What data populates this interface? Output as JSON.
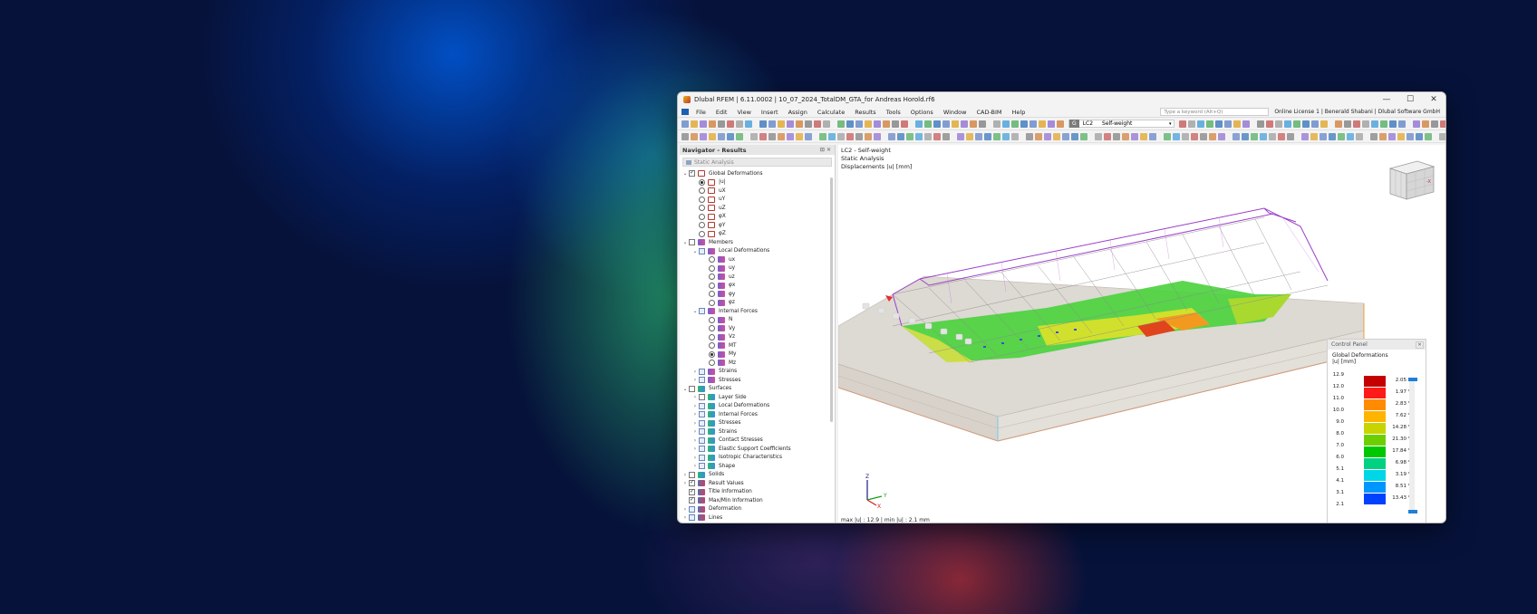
{
  "window": {
    "title": "Dlubal RFEM | 6.11.0002 | 10_07_2024_TotalDM_GTA_for Andreas Horold.rf6",
    "controls": [
      "—",
      "☐",
      "✕"
    ]
  },
  "menu": {
    "items": [
      "File",
      "Edit",
      "View",
      "Insert",
      "Assign",
      "Calculate",
      "Results",
      "Tools",
      "Options",
      "Window",
      "CAD-BIM",
      "Help"
    ],
    "search_placeholder": "Type a keyword (Alt+Q)",
    "license": "Online License 1 | Benerald Shabani | Dlubal Software GmbH"
  },
  "loadcase": {
    "code": "G",
    "id": "LC2",
    "name": "Self-weight"
  },
  "navigator": {
    "title": "Navigator - Results",
    "analysis": "Static Analysis",
    "tree": [
      {
        "level": 0,
        "exp": "v",
        "ctrl": "check-on",
        "icon": "def",
        "label": "Global Deformations"
      },
      {
        "level": 1,
        "exp": "",
        "ctrl": "radio-on",
        "icon": "def",
        "label": "|u|"
      },
      {
        "level": 1,
        "exp": "",
        "ctrl": "radio",
        "icon": "def",
        "label": "uX"
      },
      {
        "level": 1,
        "exp": "",
        "ctrl": "radio",
        "icon": "def",
        "label": "uY"
      },
      {
        "level": 1,
        "exp": "",
        "ctrl": "radio",
        "icon": "def",
        "label": "uZ"
      },
      {
        "level": 1,
        "exp": "",
        "ctrl": "radio",
        "icon": "def",
        "label": "φX"
      },
      {
        "level": 1,
        "exp": "",
        "ctrl": "radio",
        "icon": "def",
        "label": "φY"
      },
      {
        "level": 1,
        "exp": "",
        "ctrl": "radio",
        "icon": "def",
        "label": "φZ"
      },
      {
        "level": 0,
        "exp": "v",
        "ctrl": "check",
        "icon": "mem",
        "label": "Members"
      },
      {
        "level": 1,
        "exp": "v",
        "ctrl": "check-part",
        "icon": "mem",
        "label": "Local Deformations"
      },
      {
        "level": 2,
        "exp": "",
        "ctrl": "radio",
        "icon": "mem",
        "label": "ux"
      },
      {
        "level": 2,
        "exp": "",
        "ctrl": "radio",
        "icon": "mem",
        "label": "uy"
      },
      {
        "level": 2,
        "exp": "",
        "ctrl": "radio",
        "icon": "mem",
        "label": "uz"
      },
      {
        "level": 2,
        "exp": "",
        "ctrl": "radio",
        "icon": "mem",
        "label": "φx"
      },
      {
        "level": 2,
        "exp": "",
        "ctrl": "radio",
        "icon": "mem",
        "label": "φy"
      },
      {
        "level": 2,
        "exp": "",
        "ctrl": "radio",
        "icon": "mem",
        "label": "φz"
      },
      {
        "level": 1,
        "exp": "v",
        "ctrl": "check-part",
        "icon": "mem",
        "label": "Internal Forces"
      },
      {
        "level": 2,
        "exp": "",
        "ctrl": "radio",
        "icon": "mem",
        "label": "N"
      },
      {
        "level": 2,
        "exp": "",
        "ctrl": "radio",
        "icon": "mem",
        "label": "Vy"
      },
      {
        "level": 2,
        "exp": "",
        "ctrl": "radio",
        "icon": "mem",
        "label": "Vz"
      },
      {
        "level": 2,
        "exp": "",
        "ctrl": "radio",
        "icon": "mem",
        "label": "MT"
      },
      {
        "level": 2,
        "exp": "",
        "ctrl": "radio-on",
        "icon": "mem",
        "label": "My"
      },
      {
        "level": 2,
        "exp": "",
        "ctrl": "radio",
        "icon": "mem",
        "label": "Mz"
      },
      {
        "level": 1,
        "exp": ">",
        "ctrl": "check-part",
        "icon": "mem",
        "label": "Strains"
      },
      {
        "level": 1,
        "exp": ">",
        "ctrl": "check-part",
        "icon": "mem",
        "label": "Stresses"
      },
      {
        "level": 0,
        "exp": "v",
        "ctrl": "check",
        "icon": "surf",
        "label": "Surfaces"
      },
      {
        "level": 1,
        "exp": ">",
        "ctrl": "check",
        "icon": "surf",
        "label": "Layer Side"
      },
      {
        "level": 1,
        "exp": ">",
        "ctrl": "check-part",
        "icon": "surf",
        "label": "Local Deformations"
      },
      {
        "level": 1,
        "exp": ">",
        "ctrl": "check-part",
        "icon": "surf",
        "label": "Internal Forces"
      },
      {
        "level": 1,
        "exp": ">",
        "ctrl": "check-part",
        "icon": "surf",
        "label": "Stresses"
      },
      {
        "level": 1,
        "exp": ">",
        "ctrl": "check-part",
        "icon": "surf",
        "label": "Strains"
      },
      {
        "level": 1,
        "exp": ">",
        "ctrl": "check-part",
        "icon": "surf",
        "label": "Contact Stresses"
      },
      {
        "level": 1,
        "exp": ">",
        "ctrl": "check-part",
        "icon": "surf",
        "label": "Elastic Support Coefficients"
      },
      {
        "level": 1,
        "exp": ">",
        "ctrl": "check-part",
        "icon": "surf",
        "label": "Isotropic Characteristics"
      },
      {
        "level": 1,
        "exp": ">",
        "ctrl": "check-part",
        "icon": "surf",
        "label": "Shape"
      },
      {
        "level": 0,
        "exp": ">",
        "ctrl": "check",
        "icon": "surf",
        "label": "Solids"
      },
      {
        "level": 0,
        "exp": ">",
        "ctrl": "check-on",
        "icon": "misc",
        "label": "Result Values"
      },
      {
        "level": 0,
        "exp": "",
        "ctrl": "check-on",
        "icon": "misc",
        "label": "Title Information"
      },
      {
        "level": 0,
        "exp": "",
        "ctrl": "check-on",
        "icon": "misc",
        "label": "Max/Min Information"
      },
      {
        "level": 0,
        "exp": ">",
        "ctrl": "check-part",
        "icon": "misc",
        "label": "Deformation"
      },
      {
        "level": 0,
        "exp": ">",
        "ctrl": "check-part",
        "icon": "misc",
        "label": "Lines"
      }
    ]
  },
  "viewport": {
    "info": [
      "LC2 - Self-weight",
      "Static Analysis",
      "Displacements |u| [mm]"
    ],
    "footer": "max |u| : 12.9 | min |u| : 2.1 mm",
    "axis_labels": {
      "z": "Z",
      "y": "Y",
      "x": "X"
    },
    "cube_label": "-X"
  },
  "control_panel": {
    "title": "Control Panel",
    "heading": "Global Deformations",
    "unit": "|u| [mm]",
    "values": [
      "12.9",
      "12.0",
      "11.0",
      "10.0",
      "9.0",
      "8.0",
      "7.0",
      "6.0",
      "5.1",
      "4.1",
      "3.1",
      "2.1"
    ],
    "colors": [
      "#c40000",
      "#ff1a1a",
      "#ff8c00",
      "#ffb400",
      "#c8d400",
      "#6ecf00",
      "#00c800",
      "#00d282",
      "#00d7e6",
      "#0096ff",
      "#0040ff",
      "#0000b4"
    ],
    "percents": [
      "2.05 %",
      "1.97 %",
      "2.83 %",
      "7.62 %",
      "14.28 %",
      "21.30 %",
      "17.84 %",
      "6.98 %",
      "3.19 %",
      "8.51 %",
      "13.43 %"
    ]
  }
}
